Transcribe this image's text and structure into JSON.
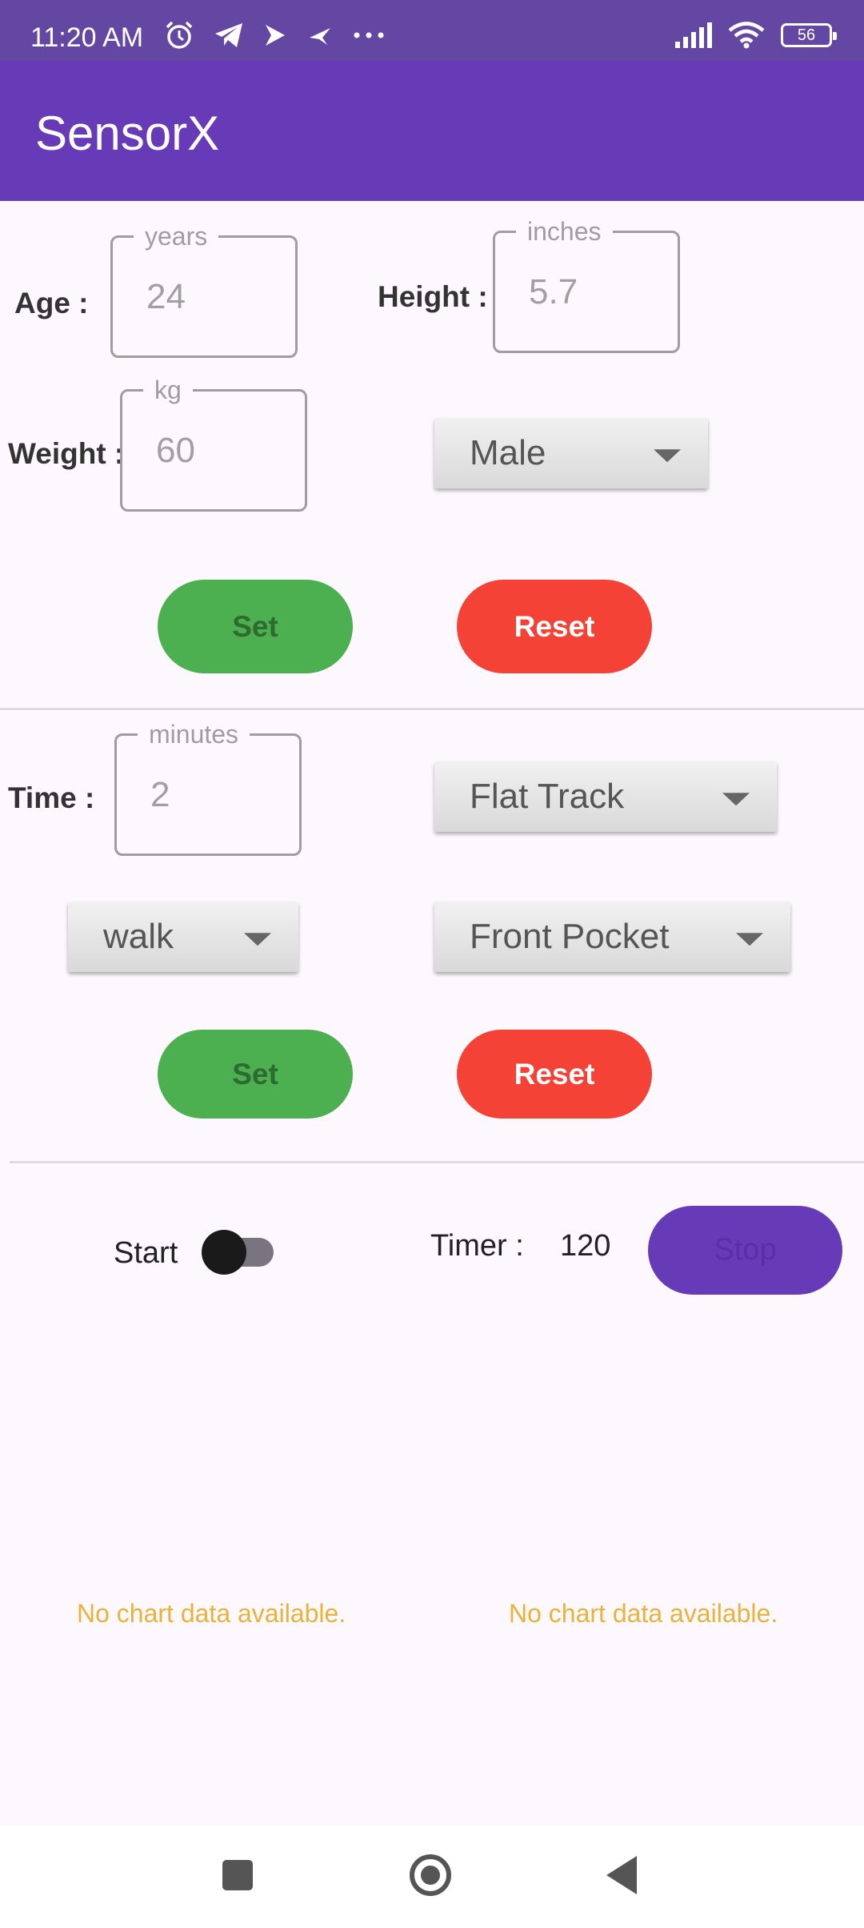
{
  "status_bar": {
    "time": "11:20 AM",
    "battery": "56",
    "icons": [
      "alarm-icon",
      "telegram-icon",
      "forward-icon",
      "bird-icon",
      "more-icon",
      "signal-icon",
      "wifi-icon",
      "battery-icon"
    ]
  },
  "app_bar": {
    "title": "SensorX"
  },
  "profile": {
    "age_label": "Age :",
    "age_unit": "years",
    "age_value": "24",
    "height_label": "Height :",
    "height_unit": "inches",
    "height_value": "5.7",
    "weight_label": "Weight :",
    "weight_unit": "kg",
    "weight_value": "60",
    "gender": "Male",
    "set_label": "Set",
    "reset_label": "Reset"
  },
  "activity": {
    "time_label": "Time :",
    "time_unit": "minutes",
    "time_value": "2",
    "track": "Flat Track",
    "activity_type": "walk",
    "position": "Front Pocket",
    "set_label": "Set",
    "reset_label": "Reset"
  },
  "controls": {
    "start_label": "Start",
    "start_on": false,
    "timer_label": "Timer :",
    "timer_value": "120",
    "stop_label": "Stop"
  },
  "charts": {
    "left_message": "No chart data available.",
    "right_message": "No chart data available."
  },
  "colors": {
    "app_bar": "#673ab7",
    "status_bar": "#6447a3",
    "set_button": "#4caf50",
    "reset_button": "#f44336",
    "no_data_text": "#e8b33a"
  }
}
